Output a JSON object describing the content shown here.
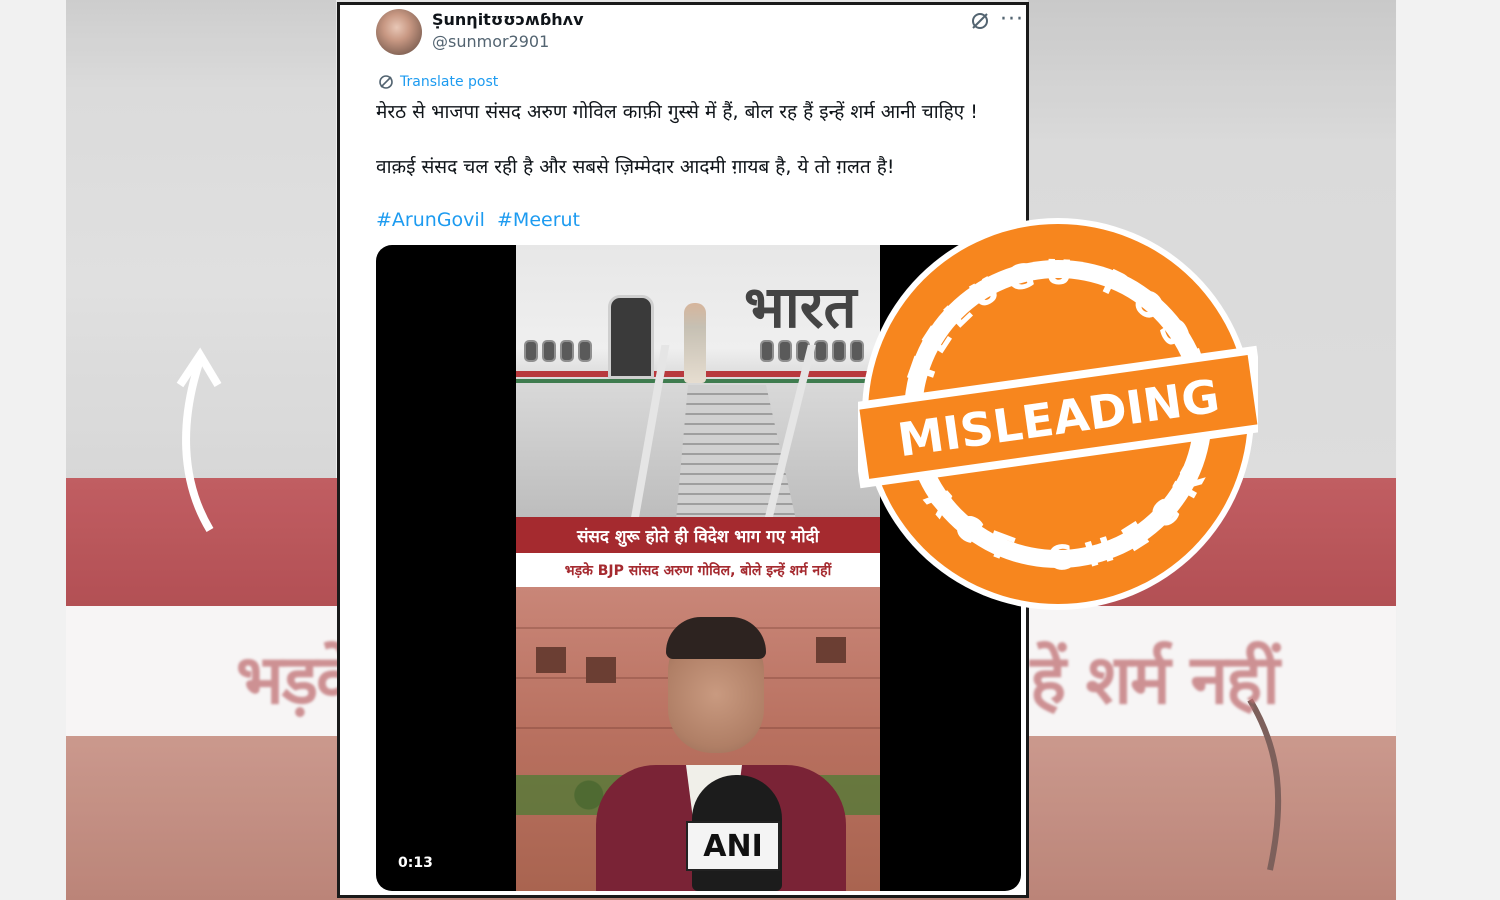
{
  "background": {
    "left_text": "भड़के",
    "right_text": "हें शर्म नहीं"
  },
  "tweet": {
    "display_name": "Ṣunηitʊʊɔʍɓhʌv",
    "handle": "@sunmor2901",
    "translate_label": "Translate post",
    "text_line1": "मेरठ से भाजपा संसद अरुण गोविल काफ़ी गुस्से में हैं, बोल रह हैं इन्हें शर्म आनी चाहिए !",
    "text_line2": "वाक़ई संसद चल रही है और सबसे ज़िम्मेदार आदमी ग़ायब है, ये तो ग़लत है!",
    "hashtags": [
      "#ArunGovil",
      "#Meerut"
    ],
    "icons": {
      "grok": "grok-icon",
      "more": "more-icon",
      "translate": "translate-icon"
    }
  },
  "video": {
    "plane_text": "भारत",
    "banner_red": "संसद शुरू होते ही विदेश भाग गए मोदी",
    "banner_white": "भड़के BJP सांसद अरुण गोविल, बोले इन्हें शर्म नहीं",
    "mic_logo": "ANI",
    "duration": "0:13"
  },
  "stamp": {
    "top_text": "TELUGU POST",
    "verdict": "MISLEADING",
    "bottom_text": "FACT CHECK",
    "color": "#f7861e"
  }
}
